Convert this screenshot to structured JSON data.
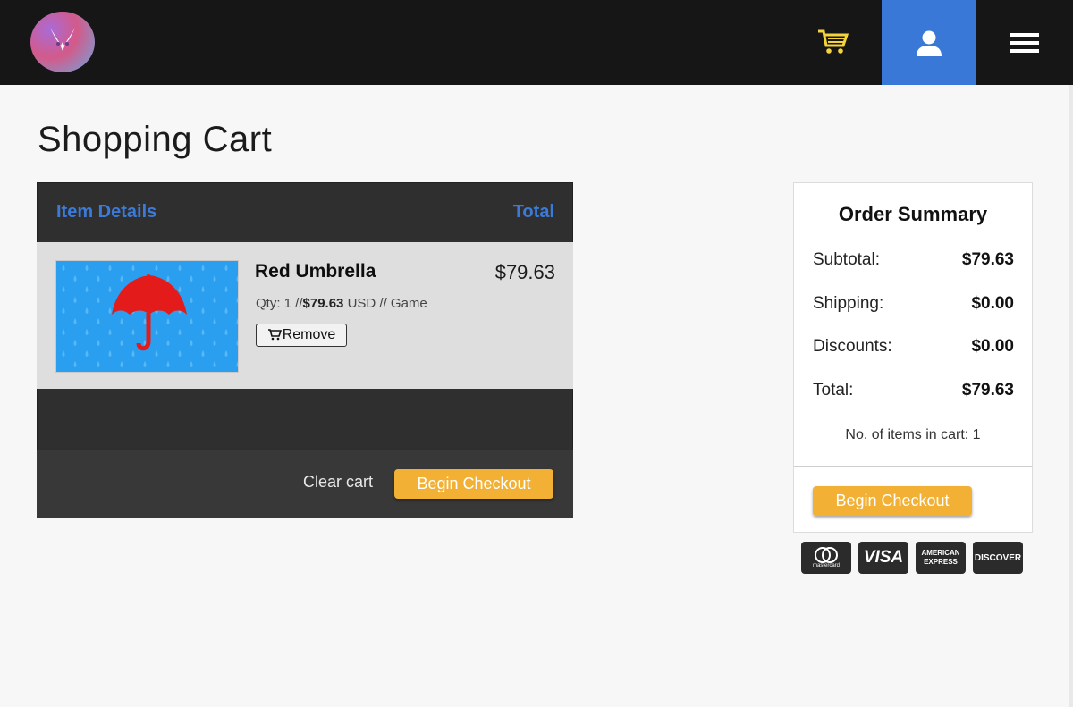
{
  "header": {
    "logo_icon": "rabbit-logo-icon",
    "cart_icon": "shopping-cart-icon",
    "user_icon": "user-icon",
    "menu_icon": "hamburger-menu-icon",
    "colors": {
      "bar": "#161616",
      "user_button": "#3a78d8",
      "cart_icon": "#f5d43a"
    }
  },
  "page": {
    "title": "Shopping Cart"
  },
  "cart": {
    "columns": {
      "details": "Item Details",
      "total": "Total"
    },
    "items": [
      {
        "name": "Red Umbrella",
        "price": "$79.63",
        "qty_prefix": "Qty: 1 //",
        "unit_price": "$79.63",
        "meta_suffix": " USD // Game",
        "remove_label": "Remove",
        "thumbnail_icon": "red-umbrella-image"
      }
    ],
    "clear_label": "Clear cart",
    "checkout_label": "Begin Checkout"
  },
  "summary": {
    "title": "Order Summary",
    "lines": [
      {
        "label": "Subtotal:",
        "value": "$79.63"
      },
      {
        "label": "Shipping:",
        "value": "$0.00"
      },
      {
        "label": "Discounts:",
        "value": "$0.00"
      },
      {
        "label": "Total:",
        "value": "$79.63"
      }
    ],
    "items_count": "No. of items in cart: 1",
    "checkout_label": "Begin Checkout"
  },
  "payment_cards": {
    "mastercard": "mastercard",
    "visa": "VISA",
    "amex_line1": "AMERICAN",
    "amex_line2": "EXPRESS",
    "discover": "DISCOVER"
  },
  "accent_colors": {
    "link_blue": "#3c7ad8",
    "checkout": "#f2b134"
  }
}
